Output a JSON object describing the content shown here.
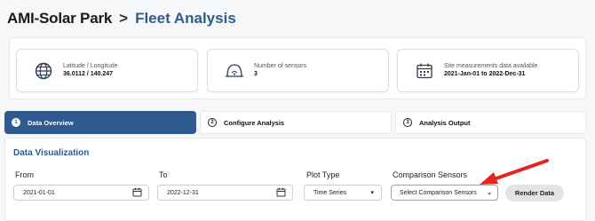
{
  "breadcrumb": {
    "root": "AMI-Solar Park",
    "separator": ">",
    "current": "Fleet Analysis"
  },
  "summary_cards": [
    {
      "icon": "globe-icon",
      "label": "Latitude / Longitude",
      "value": "36.0112 / 140.247"
    },
    {
      "icon": "sensor-icon",
      "label": "Number of sensors",
      "value": "3"
    },
    {
      "icon": "calendar-icon",
      "label": "Site measurements data available",
      "value": "2021-Jan-01 to 2022-Dec-31"
    }
  ],
  "steps": [
    {
      "number": "1",
      "label": "Data Overview",
      "active": true
    },
    {
      "number": "2",
      "label": "Configure Analysis",
      "active": false
    },
    {
      "number": "3",
      "label": "Analysis Output",
      "active": false
    }
  ],
  "visualization": {
    "title": "Data Visualization",
    "from_label": "From",
    "from_value": "2021-01-01",
    "to_label": "To",
    "to_value": "2022-12-31",
    "plot_type_label": "Plot Type",
    "plot_type_value": "Time Series",
    "comparison_label": "Comparison Sensors",
    "comparison_placeholder": "Select Comparison Sensors",
    "render_button": "Render Data"
  },
  "colors": {
    "accent": "#2e5a90",
    "annotation_arrow": "#e52420"
  }
}
